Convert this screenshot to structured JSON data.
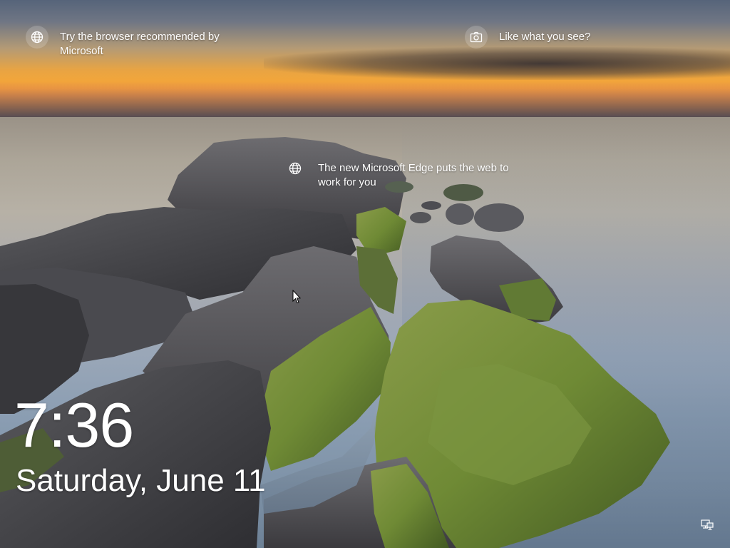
{
  "lock_screen": {
    "tips": [
      {
        "icon": "globe-icon",
        "text": "Try the browser recommended by Microsoft"
      },
      {
        "icon": "camera-icon",
        "text": "Like what you see?"
      },
      {
        "icon": "globe-icon",
        "text": "The new Microsoft Edge puts the web to work for you"
      }
    ],
    "time": "7:36",
    "date": "Saturday, June 11",
    "network_icon": "network-icon"
  }
}
